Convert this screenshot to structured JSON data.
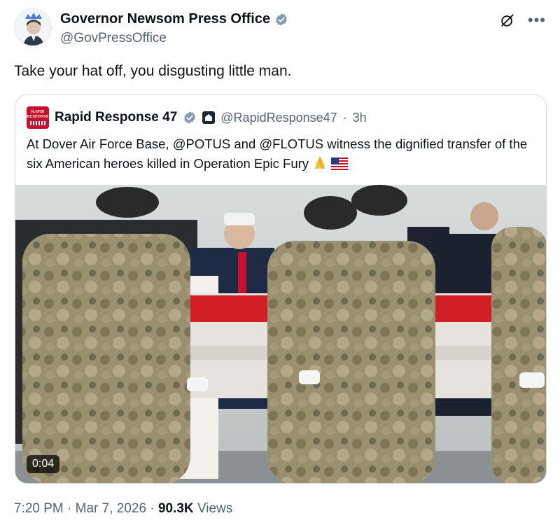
{
  "author": {
    "name": "Governor Newsom Press Office",
    "handle": "@GovPressOffice"
  },
  "tweet": {
    "text": "Take your hat off, you disgusting little man."
  },
  "quote": {
    "author_name": "Rapid Response 47",
    "handle": "@RapidResponse47",
    "separator": "·",
    "time": "3h",
    "text": "At Dover Air Force Base, @POTUS and @FLOTUS witness the dignified transfer of the six American heroes killed in Operation Epic Fury",
    "avatar_text_line1": "RAPID",
    "avatar_text_line2": "RESPONSE",
    "video_duration": "0:04"
  },
  "meta": {
    "time": "7:20 PM",
    "sep1": "·",
    "date": "Mar 7, 2026",
    "sep2": "·",
    "views_count": "90.3K",
    "views_label": "Views"
  },
  "colors": {
    "verified": "#1d9bf0",
    "text_secondary": "#536471",
    "border": "#cfd9de",
    "flag_red": "#c8102e"
  },
  "icons": {
    "verified": "verified-badge-icon",
    "grok": "grok-icon",
    "more": "more-icon",
    "pray": "folded-hands-emoji",
    "flag": "us-flag-emoji"
  }
}
